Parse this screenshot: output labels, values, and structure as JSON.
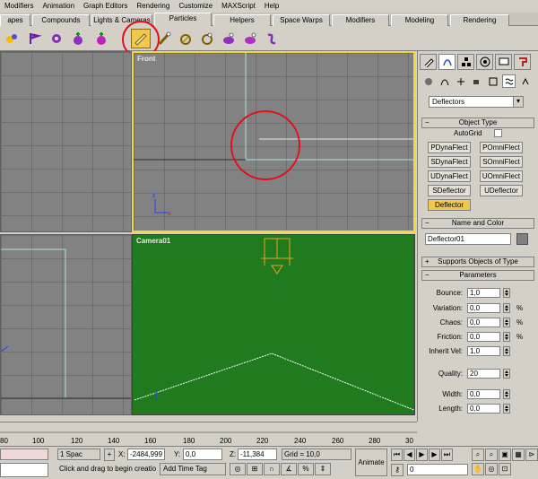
{
  "menu": [
    "Modifiers",
    "Animation",
    "Graph Editors",
    "Rendering",
    "Customize",
    "MAXScript",
    "Help"
  ],
  "tabs": [
    "apes",
    "Compounds",
    "Lights & Cameras",
    "Particles",
    "Helpers",
    "Space Warps",
    "Modifiers",
    "Modeling",
    "Rendering"
  ],
  "active_tab": "Particles",
  "viewports": {
    "front": "Front",
    "camera": "Camera01"
  },
  "cmd_panel": {
    "category_dropdown": "Deflectors",
    "object_type": {
      "title": "Object Type",
      "autogrid_label": "AutoGrid",
      "buttons": [
        "PDynaFlect",
        "POmniFlect",
        "SDynaFlect",
        "SOmniFlect",
        "UDynaFlect",
        "UOmniFlect",
        "SDeflector",
        "UDeflector",
        "Deflector"
      ]
    },
    "name_color": {
      "title": "Name and Color",
      "name_value": "Deflector01"
    },
    "supports": {
      "title": "Supports Objects of Type"
    },
    "parameters": {
      "title": "Parameters",
      "fields": [
        {
          "label": "Bounce:",
          "value": "1,0",
          "pct": ""
        },
        {
          "label": "Variation:",
          "value": "0,0",
          "pct": "%"
        },
        {
          "label": "Chaos:",
          "value": "0,0",
          "pct": "%"
        },
        {
          "label": "Friction:",
          "value": "0,0",
          "pct": "%"
        },
        {
          "label": "Inherit Vel:",
          "value": "1,0",
          "pct": ""
        },
        {
          "label": "Quality:",
          "value": "20",
          "pct": ""
        },
        {
          "label": "Width:",
          "value": "0,0",
          "pct": ""
        },
        {
          "label": "Length:",
          "value": "0,0",
          "pct": ""
        }
      ]
    }
  },
  "ruler_ticks": [
    "80",
    "100",
    "120",
    "140",
    "160",
    "180",
    "200",
    "220",
    "240",
    "260",
    "280",
    "30"
  ],
  "status": {
    "selection": "1 Spac",
    "x_value": "-2484,999",
    "y_value": "0,0",
    "z_value": "-11,384",
    "grid": "Grid = 10,0",
    "prompt": "Click and drag to begin creatio",
    "add_time_tag": "Add Time Tag",
    "animate": "Animate",
    "frame": "0",
    "x_label": "X:",
    "y_label": "Y:",
    "z_label": "Z:"
  },
  "colors": {
    "highlight_circle": "#e0101a",
    "selected_button": "#f2c84b",
    "camera_viewport": "#207a1e",
    "active_viewport_border": "#f0d840"
  }
}
